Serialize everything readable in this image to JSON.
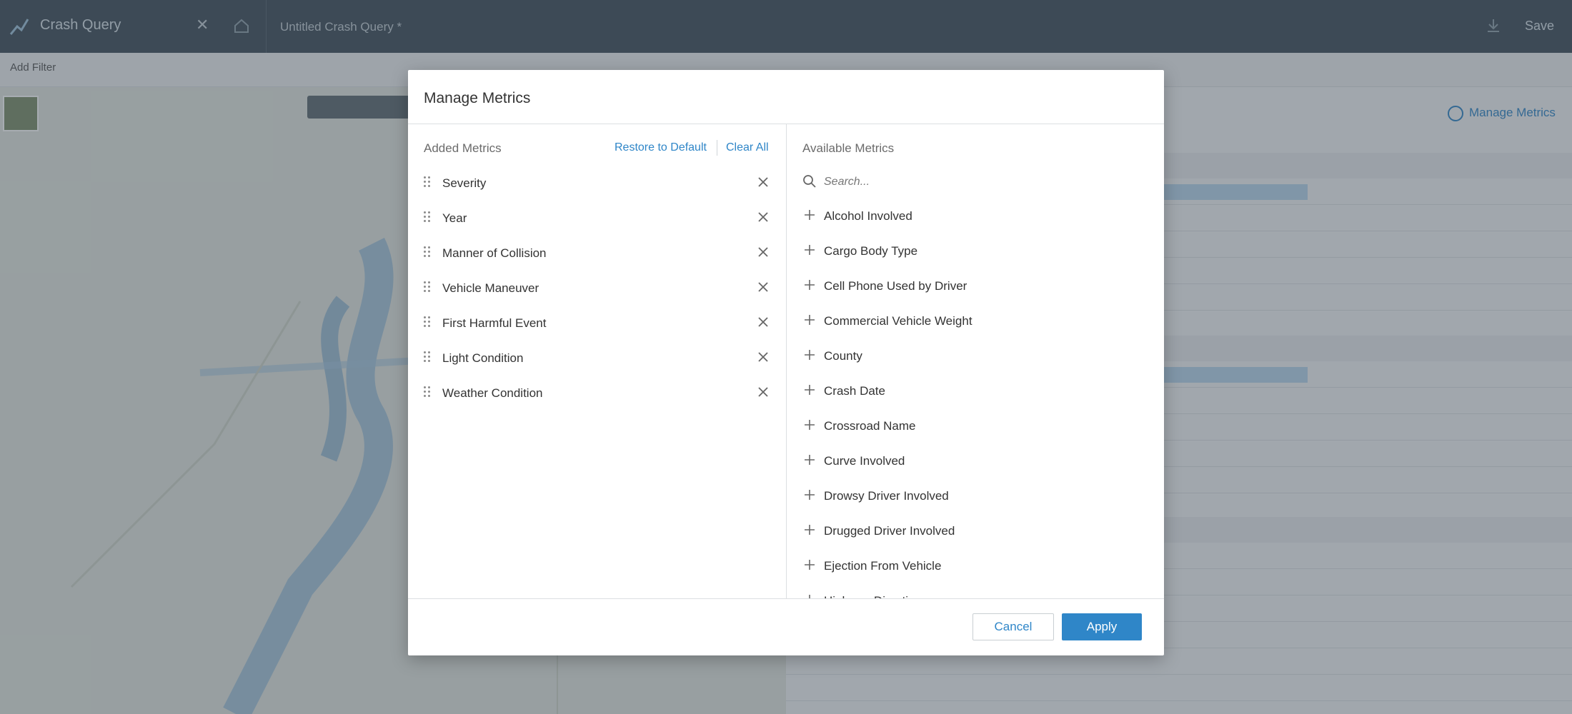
{
  "app": {
    "title": "Crash Query",
    "query_name": "Untitled Crash Query *",
    "save_label": "Save",
    "add_filter_label": "Add Filter",
    "manage_metrics_link": "Manage Metrics"
  },
  "modal": {
    "title": "Manage Metrics",
    "added": {
      "label": "Added Metrics",
      "restore_label": "Restore to Default",
      "clear_label": "Clear All",
      "items": [
        "Severity",
        "Year",
        "Manner of Collision",
        "Vehicle Maneuver",
        "First Harmful Event",
        "Light Condition",
        "Weather Condition"
      ]
    },
    "available": {
      "label": "Available Metrics",
      "search_placeholder": "Search...",
      "items": [
        "Alcohol Involved",
        "Cargo Body Type",
        "Cell Phone Used by Driver",
        "Commercial Vehicle Weight",
        "County",
        "Crash Date",
        "Crossroad Name",
        "Curve Involved",
        "Drowsy Driver Involved",
        "Drugged Driver Involved",
        "Ejection From Vehicle",
        "Highway Direction"
      ]
    },
    "cancel_label": "Cancel",
    "apply_label": "Apply"
  },
  "colors": {
    "accent": "#2f86c8",
    "topbar": "#3f4e5a",
    "overlay": "rgba(60,72,82,0.45)"
  }
}
